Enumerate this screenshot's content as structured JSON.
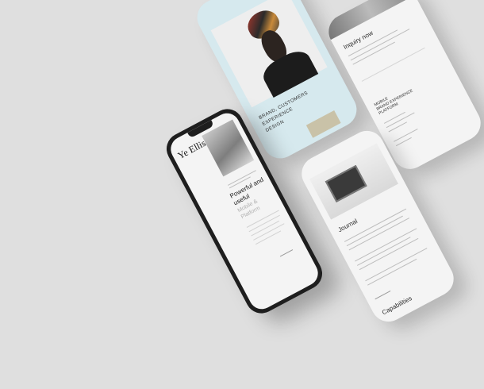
{
  "phone_main": {
    "logo": "Ye Ellis",
    "headline_line1": "Powerful and",
    "headline_line2": "useful",
    "sub_line1": "Mobile &",
    "sub_line2": "Platform"
  },
  "screen_portrait": {
    "caption_line1": "BRAND, CUSTOMERS",
    "caption_line2": "EXPERIENCE",
    "caption_line3": "DESIGN"
  },
  "screen_inquiry": {
    "heading": "Inquiry now",
    "section_line1": "MOBILE",
    "section_line2": "BRAND EXPERIENCE",
    "section_line3": "PLATFORM"
  },
  "screen_journal": {
    "heading": "Journal",
    "footer": "Capabilities"
  },
  "colors": {
    "background": "#dfdfdf",
    "phone_frame": "#1e1e1e",
    "portrait_bg": "#d6e9ee",
    "screen_bg": "#f4f4f4"
  }
}
